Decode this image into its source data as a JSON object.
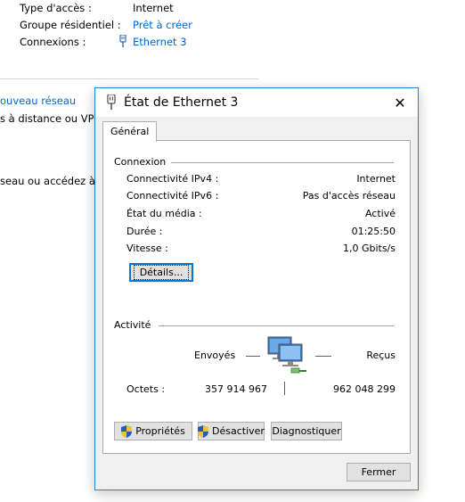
{
  "background": {
    "properties": [
      {
        "label": "Type d'accès :",
        "value": "Internet",
        "is_link": false
      },
      {
        "label": "Groupe résidentiel :",
        "value": "Prêt à créer",
        "is_link": true
      },
      {
        "label": "Connexions :",
        "value": "Ethernet 3",
        "is_link": true
      }
    ],
    "new_network_link": "ouveau réseau",
    "line1": "s à distance ou VPN,",
    "line2": "seau ou accédez à de"
  },
  "dialog": {
    "title": "État de Ethernet 3",
    "tab_label": "Général",
    "connection": {
      "group_label": "Connexion",
      "rows": [
        {
          "label": "Connectivité IPv4 :",
          "value": "Internet"
        },
        {
          "label": "Connectivité IPv6 :",
          "value": "Pas d'accès réseau"
        },
        {
          "label": "État du média :",
          "value": "Activé"
        },
        {
          "label": "Durée :",
          "value": "01:25:50"
        },
        {
          "label": "Vitesse :",
          "value": "1,0 Gbits/s"
        }
      ],
      "details_button": "Détails..."
    },
    "activity": {
      "group_label": "Activité",
      "sent_label": "Envoyés",
      "received_label": "Reçus",
      "bytes_label": "Octets :",
      "bytes_sent": "357 914 967",
      "bytes_received": "962 048 299"
    },
    "buttons": {
      "properties": "Propriétés",
      "disable": "Désactiver",
      "diagnose": "Diagnostiquer",
      "close": "Fermer"
    }
  },
  "colors": {
    "accent": "#1883d7",
    "link": "#0066cc"
  }
}
